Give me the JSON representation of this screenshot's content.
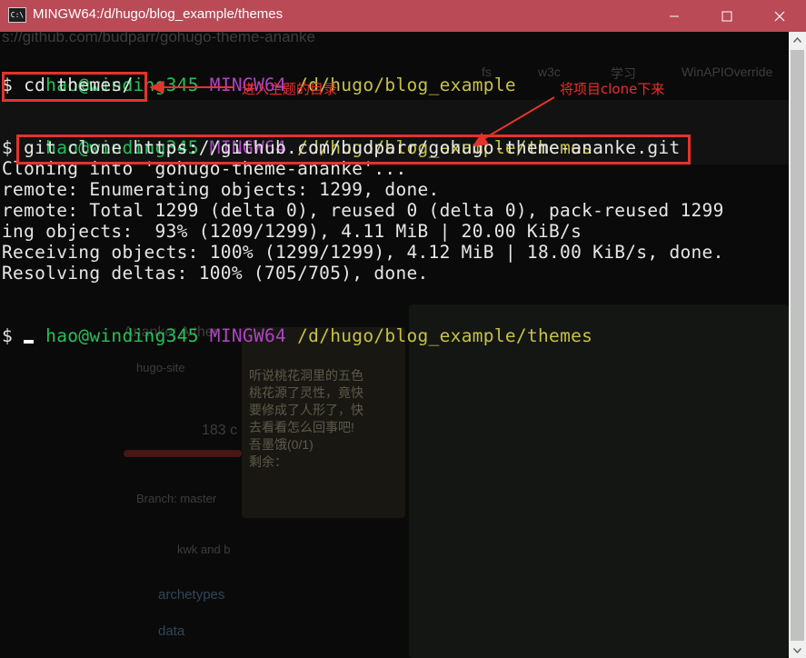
{
  "window": {
    "title": "MINGW64:/d/hugo/blog_example/themes",
    "icon_text": "C:\\",
    "controls": {
      "minimize_icon": "minimize-icon",
      "maximize_icon": "maximize-icon",
      "close_icon": "close-icon"
    }
  },
  "background_ghost": {
    "url_text": "s://github.com/budparr/gohugo-theme-ananke",
    "bookmarks": [
      "fs",
      "w3c",
      "学习",
      "WinAPIOverride"
    ],
    "sidebar": [
      "hugo-site",
      "183 c",
      "Branch: master",
      "kwk and b",
      "archetypes",
      "data"
    ],
    "ananke_text": "Ananke: A ther",
    "game_text": [
      "听说桃花洞里的五色",
      "桃花源了灵性，竟快",
      "要修成了人形了，快",
      "去看看怎么回事吧!",
      "吾墨饿(0/1)",
      "剩余："
    ]
  },
  "terminal": {
    "prompt1": {
      "user": "hao@winding345",
      "sys": "MINGW64",
      "path": "/d/hugo/blog_example"
    },
    "cmd1": "$ cd themes/",
    "prompt2": {
      "user": "hao@winding345",
      "sys": "MINGW64",
      "path": "/d/hugo/blog_example/themes"
    },
    "cmd2": "$ git clone https://github.com/budparr/gohugo-theme-ananke.git",
    "output": [
      "Cloning into 'gohugo-theme-ananke'...",
      "remote: Enumerating objects: 1299, done.",
      "remote: Total 1299 (delta 0), reused 0 (delta 0), pack-reused 1299",
      "ing objects:  93% (1209/1299), 4.11 MiB | 20.00 KiB/s",
      "Receiving objects: 100% (1299/1299), 4.12 MiB | 18.00 KiB/s, done.",
      "Resolving deltas: 100% (705/705), done."
    ],
    "prompt3": {
      "user": "hao@winding345",
      "sys": "MINGW64",
      "path": "/d/hugo/blog_example/themes"
    },
    "cmd3": "$ "
  },
  "annotations": {
    "note1": "进入主题的目录",
    "note2": "将项目clone下来"
  },
  "colors": {
    "titlebar": "#b94a56",
    "user": "#23c15a",
    "sys": "#b142c4",
    "path": "#c7c241",
    "annotation": "#e5332c"
  }
}
